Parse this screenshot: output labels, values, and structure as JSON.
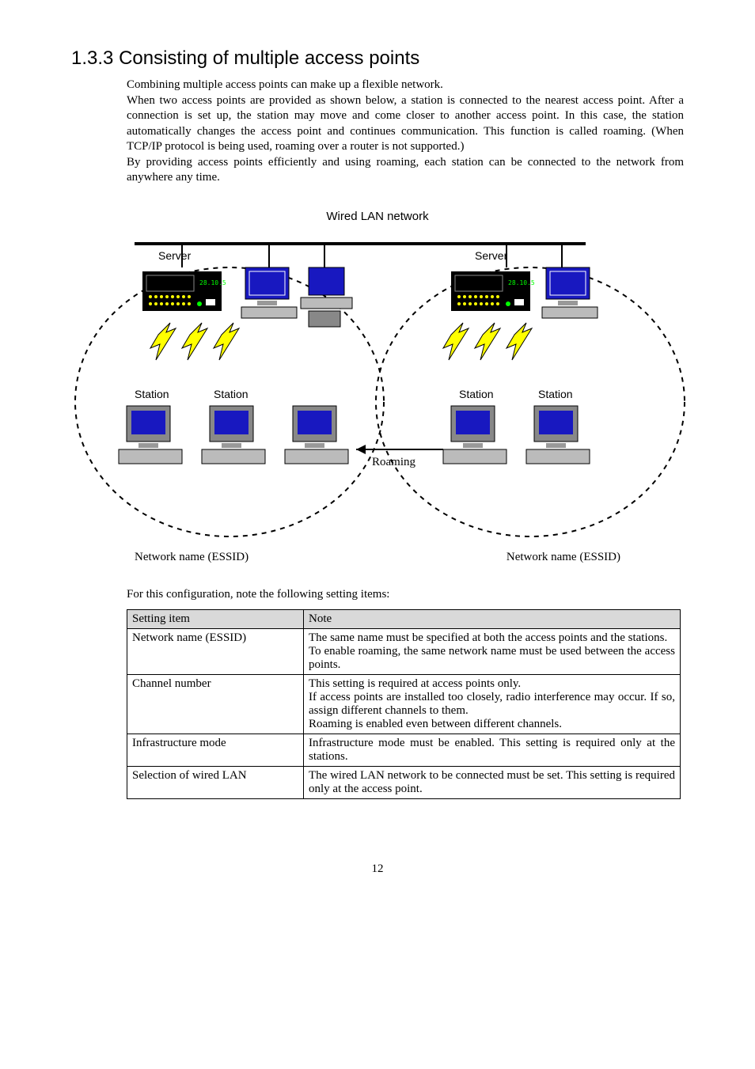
{
  "heading": {
    "number": "1.3.3",
    "title": "Consisting of multiple access points"
  },
  "paragraphs": {
    "p1": "Combining multiple access points can make up a flexible network.",
    "p2": "When two access points are provided as shown below, a station is connected to the nearest access point.  After a connection is set up, the station may move and come closer to another access point.  In this case, the station automatically changes the access point and continues communication.  This function is called roaming. (When TCP/IP protocol is being used, roaming over a router is not supported.)",
    "p3": "By providing access points efficiently and using roaming, each station can be connected to the network from anywhere any time."
  },
  "diagram": {
    "title": "Wired LAN network",
    "server_left": "Server",
    "server_right": "Server",
    "station": "Station",
    "roaming": "Roaming",
    "essid_left": "Network name (ESSID)",
    "essid_right": "Network name (ESSID)"
  },
  "table_intro": "For this configuration, note the following setting items:",
  "table": {
    "header_item": "Setting item",
    "header_note": "Note",
    "rows": [
      {
        "item": "Network name (ESSID)",
        "note": "The same name must be specified at both the access points and the stations.\nTo enable roaming, the same network name must be used between the access points."
      },
      {
        "item": "Channel number",
        "note": "This setting is required at access points only.\nIf access points are installed too closely, radio interference may occur.  If so, assign different channels to them.\nRoaming is enabled even between different channels."
      },
      {
        "item": "Infrastructure mode",
        "note": "Infrastructure mode must be enabled.  This setting is required only at the stations."
      },
      {
        "item": "Selection of wired LAN",
        "note": "The wired LAN network to be connected must be set.  This setting is required only at the access point."
      }
    ]
  },
  "page_number": "12"
}
